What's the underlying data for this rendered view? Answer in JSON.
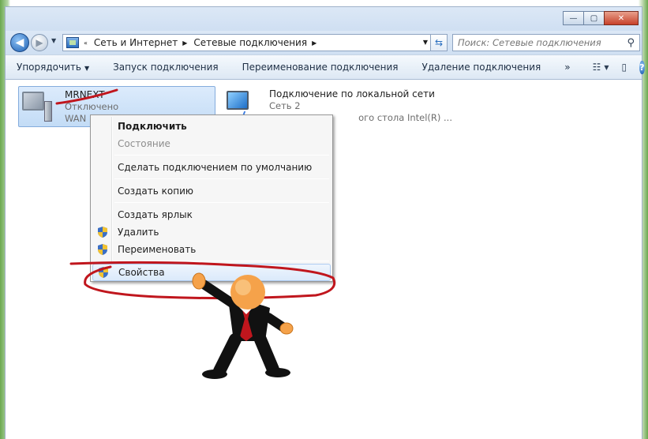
{
  "window": {
    "controls": {
      "minimize": "—",
      "maximize": "▢",
      "close": "✕"
    }
  },
  "nav": {
    "back_icon": "back-arrow-icon",
    "forward_icon": "forward-arrow-icon",
    "breadcrumb": [
      "Сеть и Интернет",
      "Сетевые подключения"
    ],
    "search_placeholder": "Поиск: Сетевые подключения"
  },
  "toolbar": {
    "organize": "Упорядочить",
    "start": "Запуск подключения",
    "rename": "Переименование подключения",
    "delete": "Удаление подключения",
    "more": "»"
  },
  "connections": [
    {
      "name": "MRNEXT",
      "status": "Отключено",
      "device": "WAN Miniport (PPPOE)",
      "icon": "dialup-connection-icon",
      "selected": true
    },
    {
      "name": "Подключение по локальной сети",
      "status": "Сеть 2",
      "device_tail": "ого стола Intel(R) ...",
      "icon": "lan-connection-icon",
      "selected": false
    }
  ],
  "context_menu": {
    "items": [
      {
        "label": "Подключить",
        "bold": true
      },
      {
        "label": "Состояние",
        "disabled": true
      },
      {
        "label": "Сделать подключением по умолчанию"
      },
      {
        "label": "Создать копию"
      },
      {
        "label": "Создать ярлык"
      },
      {
        "label": "Удалить",
        "shield": true
      },
      {
        "label": "Переименовать",
        "shield": true
      },
      {
        "label": "Свойства",
        "shield": true,
        "highlighted": true
      }
    ]
  },
  "colors": {
    "annotation_red": "#c0161d",
    "selection_bg": "#c3dcf6",
    "accent_blue": "#1d5fb3"
  }
}
